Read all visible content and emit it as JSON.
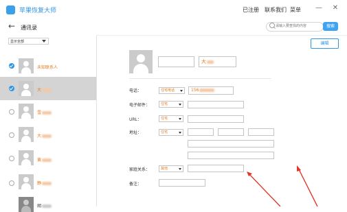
{
  "titlebar": {
    "app_title": "苹果恢复大师",
    "menu": [
      "已注册",
      "联系我们",
      "菜单"
    ],
    "controls": [
      "—",
      "✕"
    ]
  },
  "nav": {
    "back": "←",
    "title": "通讯录",
    "search_placeholder": "请输入要查找的内容",
    "search_button": "搜索"
  },
  "left": {
    "filter": "显示全部",
    "contacts": [
      {
        "name": "未知联系人",
        "checked": true
      },
      {
        "name": "大",
        "checked": true,
        "selected": true
      },
      {
        "name": "雪",
        "checked": false
      },
      {
        "name": "大",
        "checked": false
      },
      {
        "name": "黄",
        "checked": false
      },
      {
        "name": "静",
        "checked": false
      },
      {
        "name": "胡",
        "checked": false
      }
    ]
  },
  "detail": {
    "edit_button": "编辑",
    "name_last": "大",
    "phone_label": "电话：",
    "phone_type": "住宅电话",
    "phone_value": "156",
    "email_label": "电子邮件：",
    "email_type": "住宅",
    "url_label": "URL：",
    "url_type": "住宅",
    "address_label": "地址：",
    "address_type": "住宅",
    "family_label": "家庭关系：",
    "family_type": "其他",
    "note_label": "备注："
  },
  "colors": {
    "accent": "#2f95e6",
    "highlight_text": "#e57a1e",
    "annotation_arrow": "#e0392b"
  }
}
